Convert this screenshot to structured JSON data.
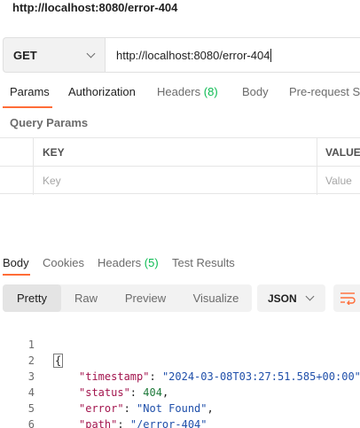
{
  "request": {
    "title": "http://localhost:8080/error-404",
    "method": "GET",
    "url": "http://localhost:8080/error-404"
  },
  "request_tabs": [
    {
      "label": "Params",
      "active": true
    },
    {
      "label": "Authorization"
    },
    {
      "label": "Headers",
      "count": "(8)"
    },
    {
      "label": "Body"
    },
    {
      "label": "Pre-request Script"
    }
  ],
  "query_params": {
    "label": "Query Params",
    "key_header": "KEY",
    "value_header": "VALUE",
    "key_placeholder": "Key",
    "value_placeholder": "Value"
  },
  "response_tabs": [
    {
      "label": "Body",
      "active": true
    },
    {
      "label": "Cookies"
    },
    {
      "label": "Headers",
      "count": "(5)"
    },
    {
      "label": "Test Results"
    }
  ],
  "view_options": [
    "Pretty",
    "Raw",
    "Preview",
    "Visualize"
  ],
  "format": "JSON",
  "response_body": {
    "line_numbers": [
      "1",
      "2",
      "3",
      "4",
      "5",
      "6"
    ],
    "open_brace": "{",
    "close_brace": "}",
    "fields": [
      {
        "key": "\"timestamp\"",
        "value": "\"2024-03-08T03:27:51.585+00:00\"",
        "sep": ","
      },
      {
        "key": "\"status\"",
        "value": "404",
        "sep": ","
      },
      {
        "key": "\"error\"",
        "value": "\"Not Found\"",
        "sep": ","
      },
      {
        "key": "\"path\"",
        "value": "\"/error-404\"",
        "sep": ""
      }
    ]
  },
  "colors": {
    "accent": "#ff6c37",
    "count": "#0cbb52",
    "json_key": "#a3154e",
    "json_string": "#1f4faa",
    "json_number": "#1e7a3a"
  }
}
